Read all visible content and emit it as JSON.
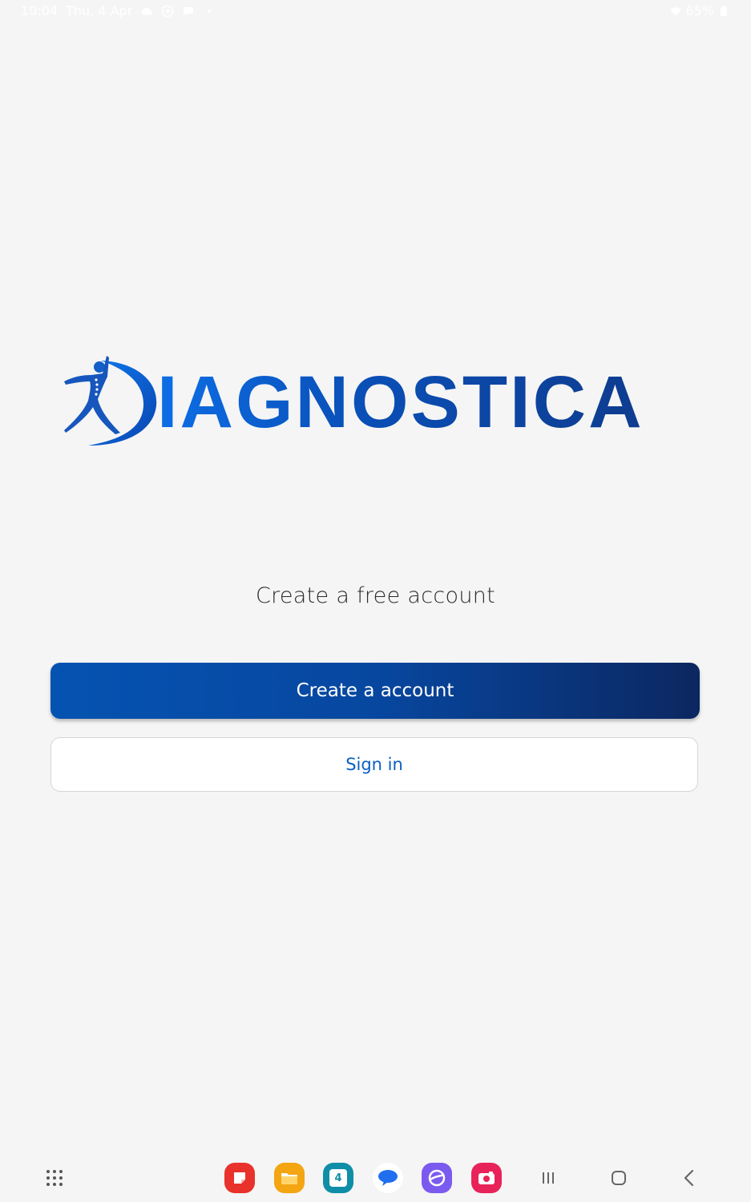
{
  "status_bar": {
    "time": "10:04",
    "date": "Thu, 4 Apr",
    "battery": "65%",
    "icons": [
      "cloud-icon",
      "sync-icon",
      "chat-icon",
      "dot-icon",
      "wifi-icon",
      "battery-icon"
    ]
  },
  "logo": {
    "wordmark": "IAGNOSTICA",
    "colors": {
      "light": "#0d6ee6",
      "dark": "#0e3c8f"
    }
  },
  "welcome": {
    "tagline": "Create a free account"
  },
  "actions": {
    "create_account_label": "Create a account",
    "sign_in_label": "Sign in"
  },
  "colors": {
    "background": "#f5f5f5",
    "primary_start": "#0553b1",
    "primary_end": "#0c2760",
    "link": "#0b5fc4"
  },
  "nav_bar": {
    "calendar_day": "4",
    "apps": [
      "app-drawer-icon",
      "notes-app-icon",
      "files-app-icon",
      "calendar-app-icon",
      "messages-app-icon",
      "browser-app-icon",
      "screen-recorder-app-icon"
    ],
    "system": [
      "recents-icon",
      "home-icon",
      "back-icon"
    ]
  }
}
